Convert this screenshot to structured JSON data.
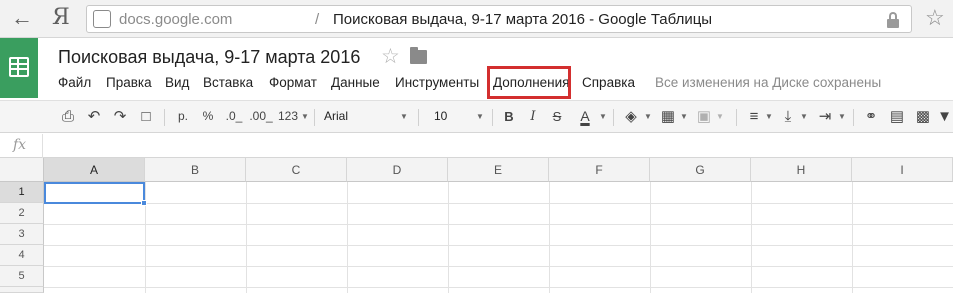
{
  "browser": {
    "back_icon": "arrow-left-icon",
    "logo_text": "Я",
    "url_domain": "docs.google.com",
    "url_separator": "/",
    "page_title": "Поисковая выдача, 9-17 марта 2016 - Google Таблицы"
  },
  "doc": {
    "title": "Поисковая выдача, 9-17 марта 2016",
    "save_status": "Все изменения на Диске сохранены"
  },
  "menu": [
    {
      "id": "file",
      "label": "Файл"
    },
    {
      "id": "edit",
      "label": "Правка"
    },
    {
      "id": "view",
      "label": "Вид"
    },
    {
      "id": "insert",
      "label": "Вставка"
    },
    {
      "id": "format",
      "label": "Формат"
    },
    {
      "id": "data",
      "label": "Данные"
    },
    {
      "id": "tools",
      "label": "Инструменты"
    },
    {
      "id": "addons",
      "label": "Дополнения",
      "highlighted": true
    },
    {
      "id": "help",
      "label": "Справка"
    }
  ],
  "toolbar": {
    "currency_label": "р.",
    "percent_label": "%",
    "decrease_decimals_label": ".0_",
    "increase_decimals_label": ".00_",
    "more_formats_label": "123",
    "font": "Arial",
    "font_size": "10",
    "bold_label": "B",
    "italic_label": "I",
    "strike_label": "S",
    "text_color_label": "A"
  },
  "formula_bar": {
    "fx_label": "fx",
    "value": ""
  },
  "grid": {
    "columns": [
      "A",
      "B",
      "C",
      "D",
      "E",
      "F",
      "G",
      "H",
      "I"
    ],
    "rows": [
      "1",
      "2",
      "3",
      "4",
      "5"
    ],
    "selected_cell": "A1"
  },
  "colors": {
    "sheets_green": "#3a9e5f",
    "highlight_red": "#d32f2f",
    "selection_blue": "#4a89dc"
  }
}
